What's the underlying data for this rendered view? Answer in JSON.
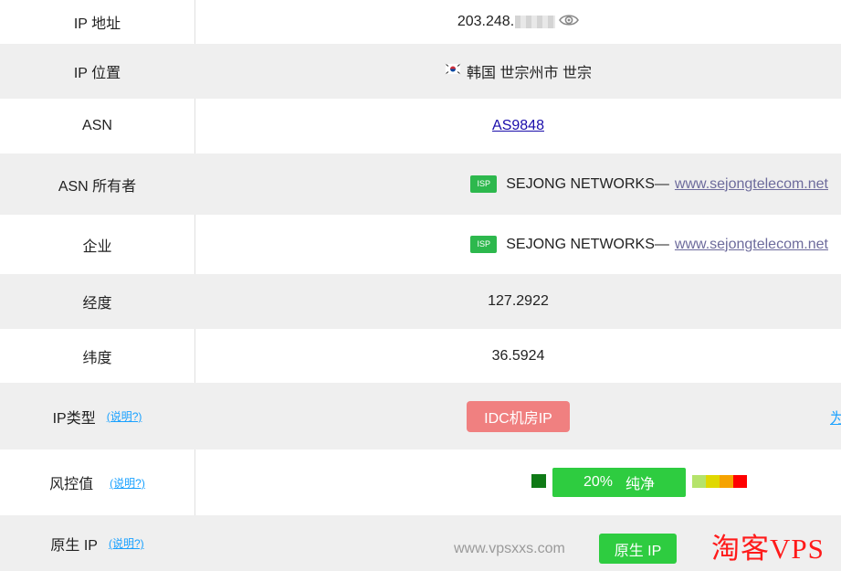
{
  "rows": {
    "ip_address": {
      "label": "IP 地址",
      "value": "203.248."
    },
    "ip_location": {
      "label": "IP 位置",
      "value": "韩国 世宗州市 世宗"
    },
    "asn": {
      "label": "ASN",
      "value": "AS9848"
    },
    "asn_owner": {
      "label": "ASN 所有者",
      "badge": "ISP",
      "name": "SEJONG NETWORKS—",
      "link": "www.sejongtelecom.net"
    },
    "company": {
      "label": "企业",
      "badge": "ISP",
      "name": "SEJONG NETWORKS—",
      "link": "www.sejongtelecom.net"
    },
    "longitude": {
      "label": "经度",
      "value": "127.2922"
    },
    "latitude": {
      "label": "纬度",
      "value": "36.5924"
    },
    "ip_type": {
      "label": "IP类型",
      "explain": "(说明?)",
      "badge": "IDC机房IP",
      "cut_link": "为"
    },
    "risk": {
      "label": "风控值",
      "explain": "(说明?)",
      "percent": "20%",
      "status": "纯净"
    },
    "native_ip": {
      "label": "原生 IP",
      "explain": "(说明?)",
      "badge": "原生 IP"
    }
  },
  "watermark": "www.vpsxxs.com",
  "brand_overlay": "淘客VPS",
  "colors": {
    "risk_scale": [
      "#b5e36b",
      "#e0d800",
      "#f6a300",
      "#ff0000"
    ],
    "accent_green": "#2ecc40",
    "idc_red": "#f08080"
  }
}
